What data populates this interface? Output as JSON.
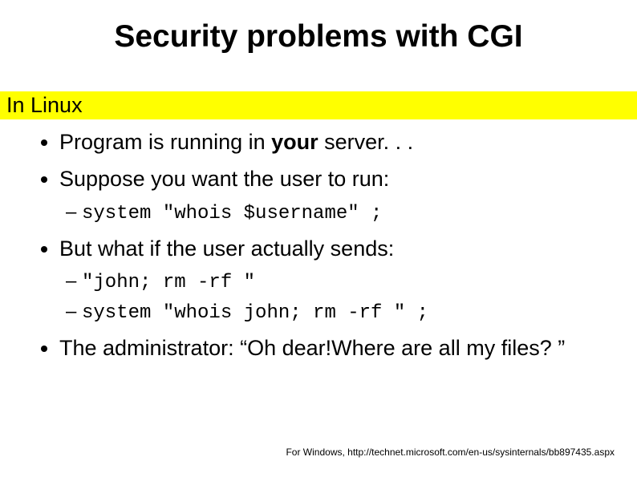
{
  "title": "Security problems with CGI",
  "heading": "In Linux",
  "bullets": {
    "b1_pre": "Program is running in ",
    "b1_bold": "your",
    "b1_post": " server. . .",
    "b2": "Suppose you want the user to run:",
    "b2_sub1": "system \"whois $username\" ;",
    "b3": "But what if the user actually sends:",
    "b3_sub1": "\"john; rm -rf \"",
    "b3_sub2": "system \"whois john; rm -rf \" ;",
    "b4": "The administrator: “Oh dear!Where are all my files? ”"
  },
  "footnote": "For Windows, http://technet.microsoft.com/en-us/sysinternals/bb897435.aspx"
}
